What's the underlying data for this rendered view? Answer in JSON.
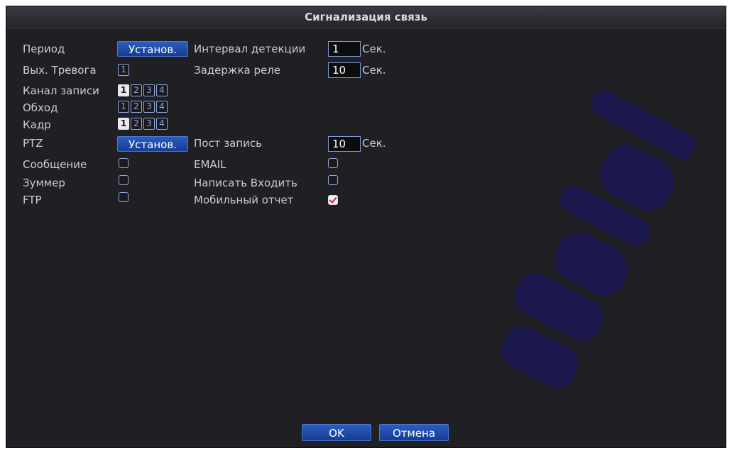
{
  "window": {
    "title": "Сигнализация связь"
  },
  "left": {
    "period_label": "Период",
    "period_button": "Установ.",
    "alarm_out_label": "Вых. Тревога",
    "alarm_out_channels": [
      {
        "n": "1",
        "on": false
      }
    ],
    "record_channel_label": "Канал записи",
    "record_channels": [
      {
        "n": "1",
        "on": true
      },
      {
        "n": "2",
        "on": false
      },
      {
        "n": "3",
        "on": false
      },
      {
        "n": "4",
        "on": false
      }
    ],
    "tour_label": "Обход",
    "tour_channels": [
      {
        "n": "1",
        "on": false
      },
      {
        "n": "2",
        "on": false
      },
      {
        "n": "3",
        "on": false
      },
      {
        "n": "4",
        "on": false
      }
    ],
    "snapshot_label": "Кадр",
    "snapshot_channels": [
      {
        "n": "1",
        "on": true
      },
      {
        "n": "2",
        "on": false
      },
      {
        "n": "3",
        "on": false
      },
      {
        "n": "4",
        "on": false
      }
    ],
    "ptz_label": "PTZ",
    "ptz_button": "Установ.",
    "message_label": "Сообщение",
    "message_checked": false,
    "buzzer_label": "Зуммер",
    "buzzer_checked": false,
    "ftp_label": "FTP",
    "ftp_checked": false
  },
  "right": {
    "interval_label": "Интервал детекции",
    "interval_value": "1",
    "interval_unit": "Сек.",
    "relay_delay_label": "Задержка реле",
    "relay_delay_value": "10",
    "relay_delay_unit": "Сек.",
    "post_record_label": "Пост запись",
    "post_record_value": "10",
    "post_record_unit": "Сек.",
    "email_label": "EMAIL",
    "email_checked": false,
    "write_log_label": "Написать Входить",
    "write_log_checked": false,
    "mobile_report_label": "Мобильный отчет",
    "mobile_report_checked": true
  },
  "footer": {
    "ok_label": "OK",
    "cancel_label": "Отмена"
  },
  "colors": {
    "background": "#1f1f24",
    "button": "#1f4aa8",
    "label": "#c9cbd6",
    "watermark": "#1a1850"
  }
}
